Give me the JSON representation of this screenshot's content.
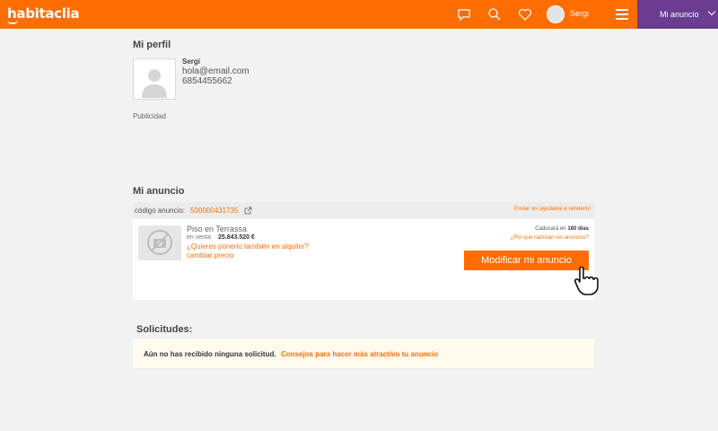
{
  "header": {
    "logo": "habitaclia",
    "username": "Sergi",
    "mi_anuncio_label": "Mi anuncio",
    "accent": "#ff6d00",
    "purple": "#6a3d92",
    "icons": [
      "chat-icon",
      "search-icon",
      "heart-icon",
      "avatar",
      "hamburger-menu-icon",
      "chevron-down-icon"
    ]
  },
  "profile": {
    "title": "Mi perfil",
    "name": "Sergi",
    "email": "hola@email.com",
    "phone": "6854455662",
    "publicidad": "Publicidad"
  },
  "ad": {
    "title": "Mi anuncio",
    "code_label": "código anuncio:",
    "code_value": "500000431735",
    "help_link": "Enviar un ¡ayúdame a venderlo!",
    "property_type": "Piso en Terrassa",
    "operation": "en venta",
    "price": "25.843.520 €",
    "rent_link": "¿Quieres ponerlo también en alquiler?",
    "change_price_link": "cambiar precio",
    "expire_prefix": "Caducará en",
    "expire_days": "180 días",
    "why_expire_link": "¿Por qué caducan los anuncios?",
    "modify_button": "Modificar mi anuncio"
  },
  "requests": {
    "title": "Solicitudes:",
    "empty_text": "Aún no has recibido ninguna solicitud.",
    "tips_link": "Consejos para hacer más atractivo tu anuncio"
  }
}
